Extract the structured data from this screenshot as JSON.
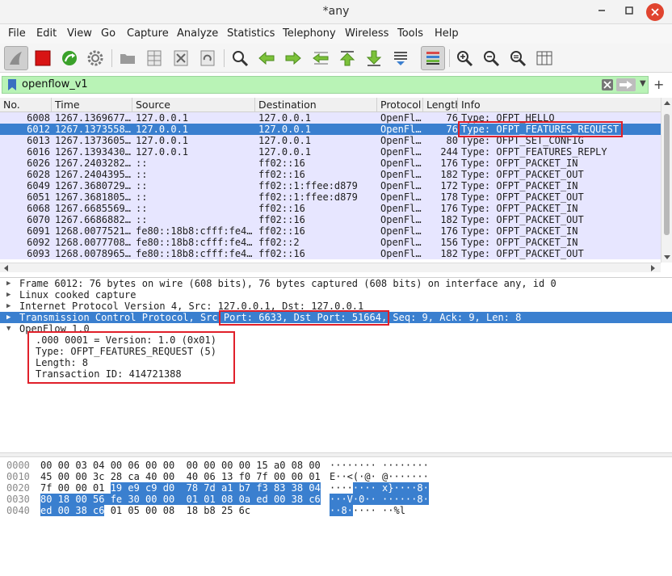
{
  "window": {
    "title": "*any"
  },
  "menu": [
    "File",
    "Edit",
    "View",
    "Go",
    "Capture",
    "Analyze",
    "Statistics",
    "Telephony",
    "Wireless",
    "Tools",
    "Help"
  ],
  "filter": {
    "value": "openflow_v1"
  },
  "packet_list": {
    "columns": [
      "No.",
      "Time",
      "Source",
      "Destination",
      "Protocol",
      "Length",
      "Info"
    ],
    "rows": [
      [
        "6008",
        "1267.1369677…",
        "127.0.0.1",
        "127.0.0.1",
        "OpenFl…",
        "76",
        "Type: OFPT_HELLO"
      ],
      [
        "6012",
        "1267.1373558…",
        "127.0.0.1",
        "127.0.0.1",
        "OpenFl…",
        "76",
        "Type: OFPT_FEATURES_REQUEST"
      ],
      [
        "6013",
        "1267.1373605…",
        "127.0.0.1",
        "127.0.0.1",
        "OpenFl…",
        "80",
        "Type: OFPT_SET_CONFIG"
      ],
      [
        "6016",
        "1267.1393430…",
        "127.0.0.1",
        "127.0.0.1",
        "OpenFl…",
        "244",
        "Type: OFPT_FEATURES_REPLY"
      ],
      [
        "6026",
        "1267.2403282…",
        "::",
        "ff02::16",
        "OpenFl…",
        "176",
        "Type: OFPT_PACKET_IN"
      ],
      [
        "6028",
        "1267.2404395…",
        "::",
        "ff02::16",
        "OpenFl…",
        "182",
        "Type: OFPT_PACKET_OUT"
      ],
      [
        "6049",
        "1267.3680729…",
        "::",
        "ff02::1:ffee:d879",
        "OpenFl…",
        "172",
        "Type: OFPT_PACKET_IN"
      ],
      [
        "6051",
        "1267.3681805…",
        "::",
        "ff02::1:ffee:d879",
        "OpenFl…",
        "178",
        "Type: OFPT_PACKET_OUT"
      ],
      [
        "6068",
        "1267.6685569…",
        "::",
        "ff02::16",
        "OpenFl…",
        "176",
        "Type: OFPT_PACKET_IN"
      ],
      [
        "6070",
        "1267.6686882…",
        "::",
        "ff02::16",
        "OpenFl…",
        "182",
        "Type: OFPT_PACKET_OUT"
      ],
      [
        "6091",
        "1268.0077521…",
        "fe80::18b8:cfff:fe4…",
        "ff02::16",
        "OpenFl…",
        "176",
        "Type: OFPT_PACKET_IN"
      ],
      [
        "6092",
        "1268.0077708…",
        "fe80::18b8:cfff:fe4…",
        "ff02::2",
        "OpenFl…",
        "156",
        "Type: OFPT_PACKET_IN"
      ],
      [
        "6093",
        "1268.0078965…",
        "fe80::18b8:cfff:fe4…",
        "ff02::16",
        "OpenFl…",
        "182",
        "Type: OFPT_PACKET_OUT"
      ]
    ],
    "selected_index": 1
  },
  "details": {
    "frame": "Frame 6012: 76 bytes on wire (608 bits), 76 bytes captured (608 bits) on interface any, id 0",
    "linux": "Linux cooked capture",
    "ip": "Internet Protocol Version 4, Src: 127.0.0.1, Dst: 127.0.0.1",
    "tcp_a": "Transmission Control Protocol, Src ",
    "tcp_b": "Port: 6633, Dst Port: 51664,",
    "tcp_c": " Seq: 9, Ack: 9, Len: 8",
    "openflow": "OpenFlow 1.0",
    "of_fields": [
      ".000 0001 = Version: 1.0 (0x01)",
      "Type: OFPT_FEATURES_REQUEST (5)",
      "Length: 8",
      "Transaction ID: 414721388"
    ]
  },
  "bytes": [
    {
      "off": "0000",
      "hex_plain": "00 00 03 04 00 06 00 00  00 00 00 00 15 a0 08 00",
      "hex_hl": "",
      "hex_tail": "",
      "ascii_plain": "········ ········",
      "ascii_hl": "",
      "ascii_tail": ""
    },
    {
      "off": "0010",
      "hex_plain": "45 00 00 3c 28 ca 40 00  40 06 13 f0 7f 00 00 01",
      "hex_hl": "",
      "hex_tail": "",
      "ascii_plain": "E··<(·@· @·······",
      "ascii_hl": "",
      "ascii_tail": ""
    },
    {
      "off": "0020",
      "hex_plain": "7f 00 00 01 ",
      "hex_hl": "19 e9 c9 d0  78 7d a1 b7 f3 83 38 04",
      "hex_tail": "",
      "ascii_plain": "····",
      "ascii_hl": "···· x}····8·",
      "ascii_tail": ""
    },
    {
      "off": "0030",
      "hex_plain": "",
      "hex_hl": "80 18 00 56 fe 30 00 00  01 01 08 0a ed 00 38 c6",
      "hex_tail": "",
      "ascii_plain": "",
      "ascii_hl": "···V·0·· ······8·",
      "ascii_tail": ""
    },
    {
      "off": "0040",
      "hex_plain": "",
      "hex_hl": "ed 00 38 c6",
      "hex_tail": " 01 05 00 08  18 b8 25 6c",
      "ascii_plain": "",
      "ascii_hl": "··8·",
      "ascii_tail": "···· ··%l"
    }
  ]
}
